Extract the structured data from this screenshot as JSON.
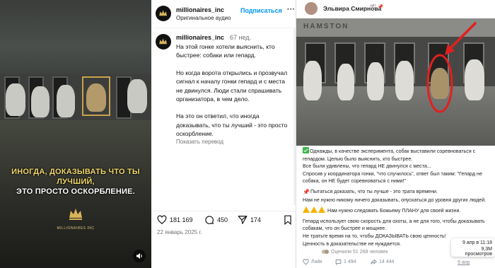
{
  "reel": {
    "caption_line1": "ИНОГДА, ДОКАЗЫВАТЬ ЧТО ТЫ ЛУЧШИЙ,",
    "caption_line2": "ЭТО ПРОСТО ОСКОРБЛЕНИЕ.",
    "logo_text": "MILLIONAIRES INC",
    "icons": {
      "sound": "speaker-icon",
      "logo": "crown-logo-icon"
    },
    "colors": {
      "caption": "#f3d86a",
      "highlight": "#c9a34a"
    }
  },
  "instagram": {
    "username": "millionaires_inc",
    "audio": "Оригинальное аудио",
    "follow_label": "Подписаться",
    "more_label": "···",
    "comment": {
      "username": "millionaires_inc",
      "time": "67 нед.",
      "paragraphs": [
        "На этой гонке хотели выяснить, кто быстрее: собаки или гепард.",
        "Но когда ворота открылись и прозвучал сигнал к началу гонки гепард и с места не двинулся. Люди стали спрашивать организатора, в чем дело.",
        "На это он ответил, что иногда доказывать, что ты лучший - это просто оскорбление."
      ],
      "translate_label": "Показать перевод"
    },
    "likes": "181 169",
    "comments": "450",
    "shares": "174",
    "date": "22 январь 2025 г.",
    "icons": [
      "heart-icon",
      "comment-icon",
      "send-icon",
      "bookmark-icon"
    ]
  },
  "vk": {
    "author": "Эльвира Смирнова",
    "author_badges": "🕊 📌",
    "image_banner": "HAMSTON",
    "post_lines": [
      {
        "emoji": "check",
        "text": "Однажды, в качестве эксперимента, собак выставили соревноваться с гепардом. Целью было выяснить, кто быстрее."
      },
      {
        "emoji": "",
        "text": "Все были удивлены, что гепард НЕ двинулся с места..."
      },
      {
        "emoji": "",
        "text": "Спросив у координатора гонки, \"что случилось\", ответ был таким: \"Гепард не собака, он НЕ будет соревноваться с ними!\""
      },
      {
        "emoji": "pin",
        "text": "Пытаться доказать, что ты лучше - это трата времени."
      },
      {
        "emoji": "",
        "text": "Нам не нужно никому ничего доказывать, опускаться до уровня других людей."
      },
      {
        "emoji": "warn3",
        "text": "Нам нужно следовать Божьему ПЛАНУ для своей жизни."
      },
      {
        "emoji": "",
        "text": "Гепард использует свою скорость для охоты, а не для того, чтобы доказывать собакам, что он быстрее и мощнее."
      },
      {
        "emoji": "",
        "text": "Не тратьте время на то, чтобы ДОКАЗЫВАТЬ свою ценность!"
      },
      {
        "emoji": "",
        "text": "Ценность в доказательстве не нуждается."
      }
    ],
    "rated": "Оценили 51 268 человек",
    "like_label": "Лайк",
    "comments": "1 494",
    "shares": "14 444",
    "tooltip_line1": "9 апр в 11:18",
    "tooltip_line2": "9,3M просмотров",
    "date": "9 апр",
    "colors": {
      "annotation": "#e02020",
      "link": "#818c99"
    }
  }
}
